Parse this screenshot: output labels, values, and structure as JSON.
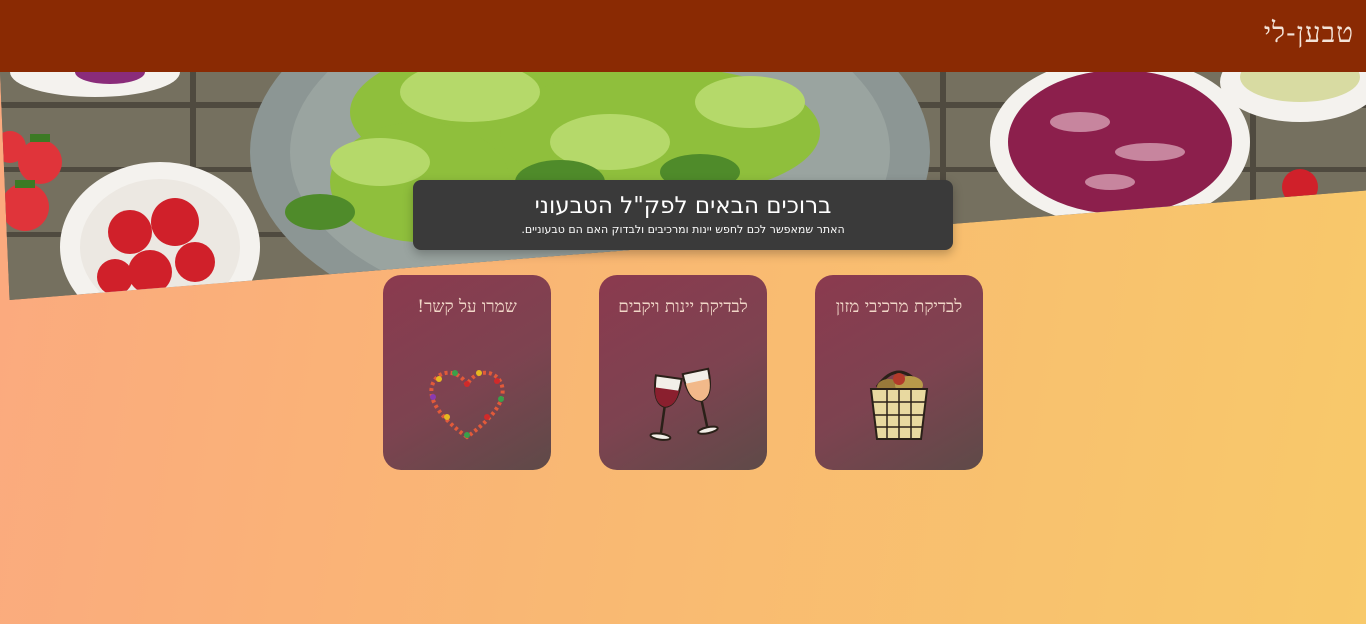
{
  "header": {
    "brand": "טבען-לי"
  },
  "hero": {
    "title": "ברוכים הבאים לפק\"ל הטבעוני",
    "subtitle": "האתר שמאפשר לכם לחפש יינות ומרכיבים ולבדוק האם הם טבעוניים."
  },
  "cards": [
    {
      "label": "לבדיקת מרכיבי מזון",
      "icon": "basket-icon"
    },
    {
      "label": "לבדיקת יינות ויקבים",
      "icon": "wine-glasses-icon"
    },
    {
      "label": "שמרו על קשר!",
      "icon": "heart-icon"
    }
  ],
  "colors": {
    "header": "#8a2a03",
    "welcome_box": "#3a3a3a",
    "card": "#7d4350"
  }
}
